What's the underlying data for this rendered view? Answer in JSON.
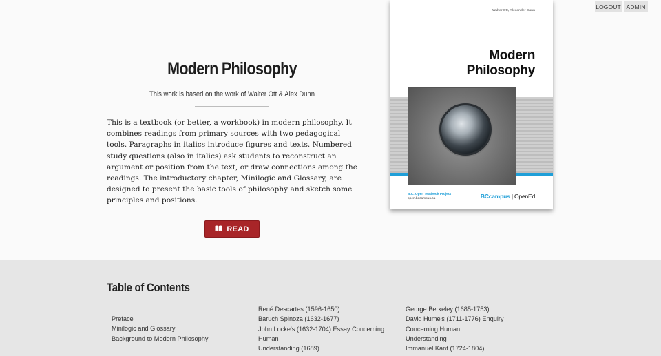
{
  "header": {
    "logout_label": "LOGOUT",
    "admin_label": "ADMIN"
  },
  "book": {
    "title": "Modern Philosophy",
    "attribution": "This work is based on the work of Walter Ott & Alex Dunn",
    "description": "This is a textbook (or better, a workbook) in modern philosophy. It combines readings from primary sources with two pedagogical tools. Paragraphs in italics introduce figures and texts. Numbered study questions (also in italics) ask students to reconstruct an argument or position from the text, or draw connections among the readings. The introductory chapter, Minilogic and Glossary, are designed to present the basic tools of philosophy and sketch some principles and positions.",
    "read_label": "READ",
    "read_icon": "book-open-icon"
  },
  "cover": {
    "authors": "Walter Ott, Alexander Dunn",
    "title_line1": "Modern",
    "title_line2": "Philosophy",
    "footer_left_line1": "B.C. Open Textbook Project",
    "footer_left_line2": "open.bccampus.ca",
    "footer_right_brand": "BCcampus",
    "footer_right_text": "OpenEd",
    "accent": "#1f9fd8"
  },
  "toc": {
    "heading": "Table of Contents",
    "columns": [
      [
        "Preface",
        "Minilogic and Glossary",
        "Background to Modern Philosophy"
      ],
      [
        "René Descartes (1596-1650)",
        "Baruch Spinoza (1632-1677)",
        "John Locke's (1632-1704) Essay Concerning Human",
        "Understanding (1689)"
      ],
      [
        "George Berkeley (1685-1753)",
        "David Hume's (1711-1776) Enquiry Concerning Human",
        "Understanding",
        "Immanuel Kant (1724-1804)"
      ]
    ]
  },
  "colors": {
    "read_button": "#a82528",
    "toc_background": "#e6e6e6",
    "page_background": "#fafafa"
  }
}
